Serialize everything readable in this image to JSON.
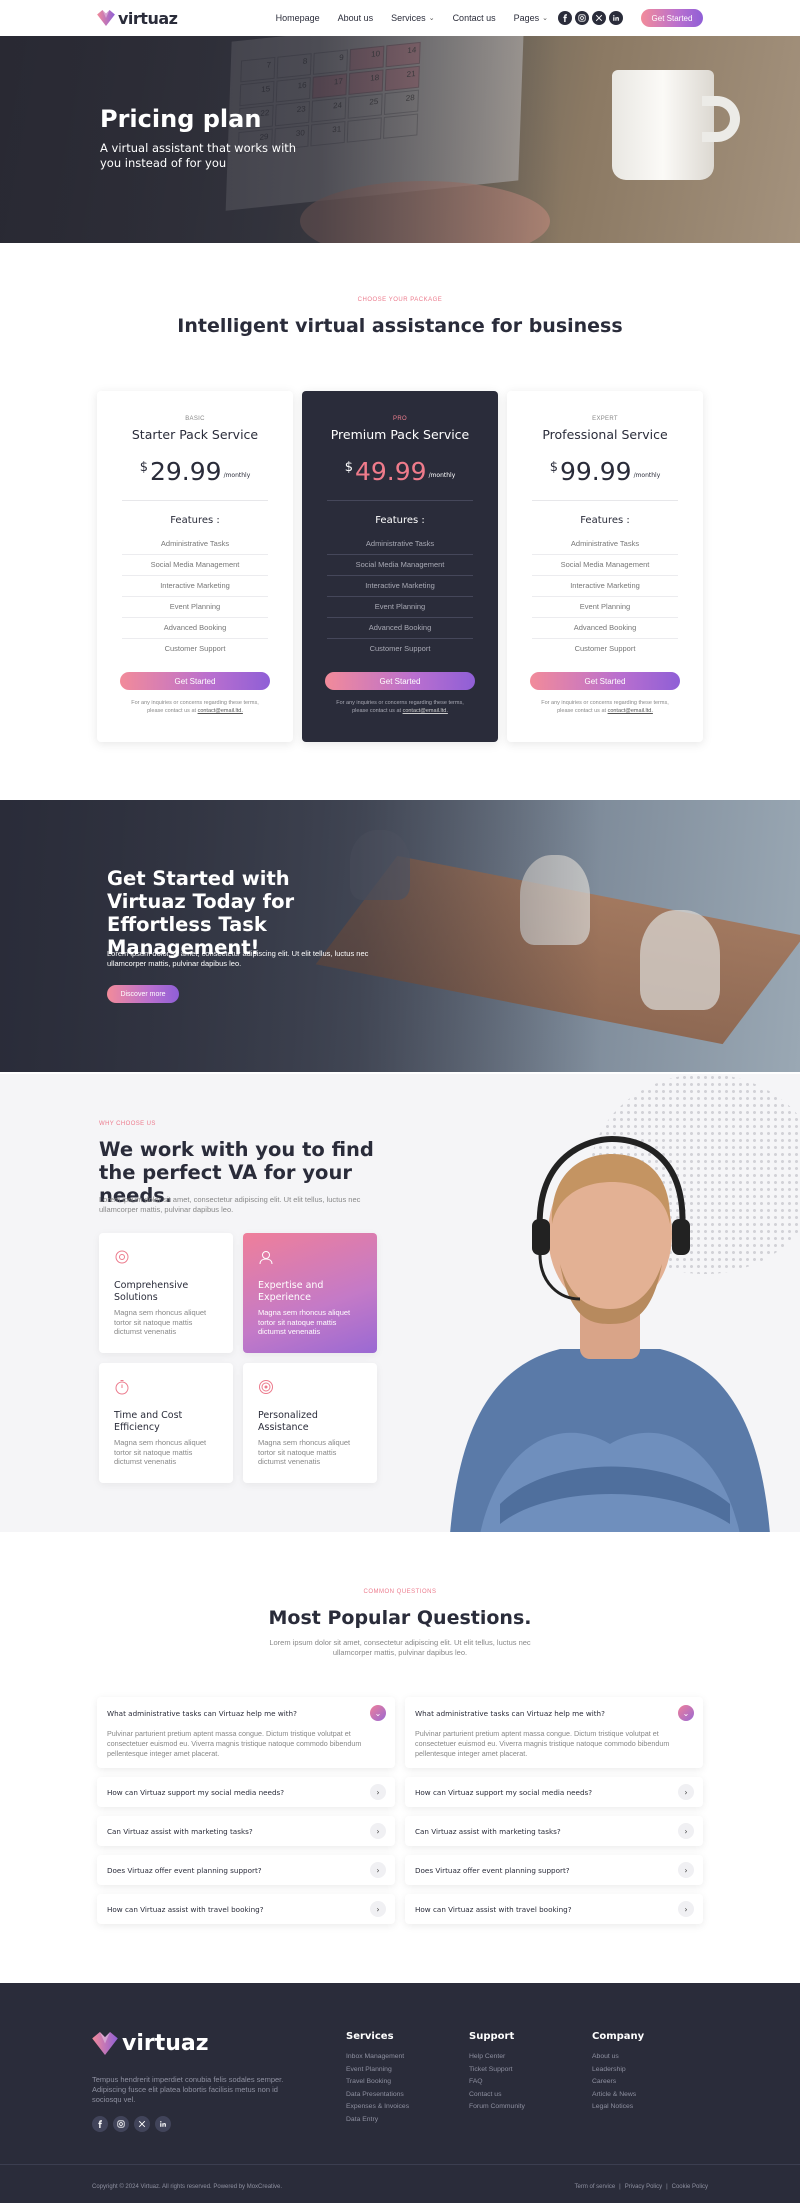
{
  "brand": {
    "name": "virtuaz",
    "accent": "#ec7b8d",
    "accent2": "#9a69d3",
    "dark": "#2a2c3a"
  },
  "nav": {
    "items": [
      "Homepage",
      "About us",
      "Services",
      "Contact us",
      "Pages"
    ],
    "cta": "Get Started",
    "socials": [
      "facebook-icon",
      "instagram-icon",
      "x-icon",
      "linkedin-icon"
    ]
  },
  "hero": {
    "title": "Pricing plan",
    "subtitle": "A virtual assistant that works with you instead of for you",
    "calendar_numbers": [
      "7",
      "8",
      "9",
      "10",
      "14",
      "15",
      "16",
      "17",
      "18",
      "21",
      "22",
      "23",
      "24",
      "25",
      "28",
      "29",
      "30",
      "31"
    ]
  },
  "pricing": {
    "kicker": "CHOOSE YOUR PACKAGE",
    "title_plain": "Intelligent virtual assistance ",
    "title_bold": "for business",
    "plans": [
      {
        "tier": "BASIC",
        "name": "Starter Pack Service",
        "currency": "$",
        "price": "29.99",
        "period": "/monthly",
        "features_title": "Features :",
        "features": [
          "Administrative Tasks",
          "Social Media Management",
          "Interactive Marketing",
          "Event Planning",
          "Advanced Booking",
          "Customer Support"
        ],
        "button": "Get Started",
        "note": "For any inquiries or concerns regarding these terms, please contact us at ",
        "email": "contact@email.ltd."
      },
      {
        "tier": "PRO",
        "name": "Premium Pack Service",
        "currency": "$",
        "price": "49.99",
        "period": "/monthly",
        "features_title": "Features :",
        "features": [
          "Administrative Tasks",
          "Social Media Management",
          "Interactive Marketing",
          "Event Planning",
          "Advanced Booking",
          "Customer Support"
        ],
        "button": "Get Started",
        "note": "For any inquiries or concerns regarding these terms, please contact us at ",
        "email": "contact@email.ltd."
      },
      {
        "tier": "EXPERT",
        "name": "Professional Service",
        "currency": "$",
        "price": "99.99",
        "period": "/monthly",
        "features_title": "Features :",
        "features": [
          "Administrative Tasks",
          "Social Media Management",
          "Interactive Marketing",
          "Event Planning",
          "Advanced Booking",
          "Customer Support"
        ],
        "button": "Get Started",
        "note": "For any inquiries or concerns regarding these terms, please contact us at ",
        "email": "contact@email.ltd."
      }
    ]
  },
  "cta": {
    "title": "Get Started with Virtuaz Today for Effortless Task Management!",
    "text": "Lorem ipsum dolor sit amet, consectetur adipiscing elit. Ut elit tellus, luctus nec ullamcorper mattis, pulvinar dapibus leo.",
    "button": "Discover more"
  },
  "why": {
    "kicker": "WHY CHOOSE US",
    "title": "We work with you to find the perfect VA for your needs.",
    "text": "Lorem ipsum dolor sit amet, consectetur adipiscing elit. Ut elit tellus, luctus nec ullamcorper mattis, pulvinar dapibus leo.",
    "features": [
      {
        "icon": "gear-icon",
        "title": "Comprehensive Solutions",
        "text": "Magna sem rhoncus aliquet tortor sit natoque mattis dictumst venenatis"
      },
      {
        "icon": "user-support-icon",
        "title": "Expertise and Experience",
        "text": "Magna sem rhoncus aliquet tortor sit natoque mattis dictumst venenatis"
      },
      {
        "icon": "stopwatch-icon",
        "title": "Time and Cost Efficiency",
        "text": "Magna sem rhoncus aliquet tortor sit natoque mattis dictumst venenatis"
      },
      {
        "icon": "target-icon",
        "title": "Personalized Assistance",
        "text": "Magna sem rhoncus aliquet tortor sit natoque mattis dictumst venenatis"
      }
    ]
  },
  "faq": {
    "kicker": "COMMON QUESTIONS",
    "title_plain": "Most Popular ",
    "title_bold": "Questions",
    "title_end": ".",
    "subtitle": "Lorem ipsum dolor sit amet, consectetur adipiscing elit. Ut elit tellus, luctus nec ullamcorper mattis, pulvinar dapibus leo.",
    "left": [
      {
        "q": "What administrative tasks can Virtuaz help me with?",
        "a": "Pulvinar parturient pretium aptent massa congue. Dictum tristique volutpat et consectetuer euismod eu. Viverra magnis tristique natoque commodo bibendum pellentesque integer amet placerat."
      },
      {
        "q": "How can Virtuaz support my social media needs?"
      },
      {
        "q": "Can Virtuaz assist with marketing tasks?"
      },
      {
        "q": "Does Virtuaz offer event planning support?"
      },
      {
        "q": "How can Virtuaz assist with travel booking?"
      }
    ],
    "right": [
      {
        "q": "What administrative tasks can Virtuaz help me with?",
        "a": "Pulvinar parturient pretium aptent massa congue. Dictum tristique volutpat et consectetuer euismod eu. Viverra magnis tristique natoque commodo bibendum pellentesque integer amet placerat."
      },
      {
        "q": "How can Virtuaz support my social media needs?"
      },
      {
        "q": "Can Virtuaz assist with marketing tasks?"
      },
      {
        "q": "Does Virtuaz offer event planning support?"
      },
      {
        "q": "How can Virtuaz assist with travel booking?"
      }
    ]
  },
  "footer": {
    "brand": "virtuaz",
    "desc": "Tempus hendrerit imperdiet conubia felis sodales semper. Adipiscing fusce elit platea lobortis facilisis metus non id sociosqu vel.",
    "columns": [
      {
        "title": "Services",
        "links": [
          "Inbox Management",
          "Event Planning",
          "Travel Booking",
          "Data Presentations",
          "Expenses & Invoices",
          "Data Entry"
        ]
      },
      {
        "title": "Support",
        "links": [
          "Help Center",
          "Ticket Support",
          "FAQ",
          "Contact us",
          "Forum Community"
        ]
      },
      {
        "title": "Company",
        "links": [
          "About us",
          "Leadership",
          "Careers",
          "Article & News",
          "Legal Notices"
        ]
      }
    ],
    "copyright": "Copyright © 2024 Virtuaz. All rights reserved. Powered by MoxCreative.",
    "legal": [
      "Term of service",
      "Privacy Policy",
      "Cookie Policy"
    ]
  }
}
